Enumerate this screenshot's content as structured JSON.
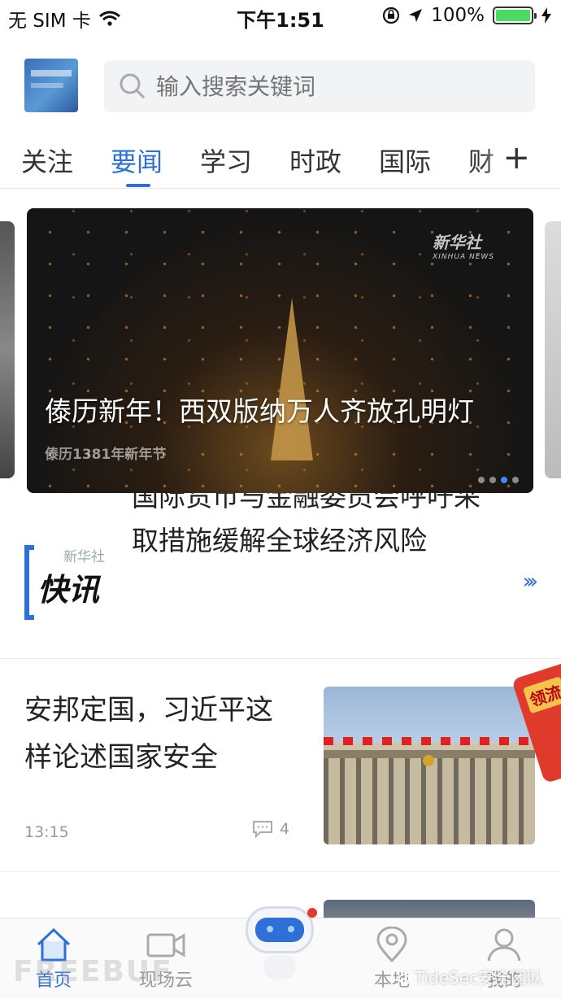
{
  "status_bar": {
    "carrier": "无 SIM 卡",
    "time": "下午1:51",
    "battery": "100%"
  },
  "header": {
    "search_placeholder": "输入搜索关键词"
  },
  "tabs": [
    {
      "label": "关注"
    },
    {
      "label": "要闻"
    },
    {
      "label": "学习"
    },
    {
      "label": "时政"
    },
    {
      "label": "国际"
    },
    {
      "label": "财"
    }
  ],
  "active_tab": "要闻",
  "carousel": {
    "title": "傣历新年！西双版纳万人齐放孔明灯",
    "brand": "新华社",
    "brand_sub": "XINHUA NEWS",
    "overlay_caption": "傣历1381年新年节",
    "dots": 4,
    "active_dot": 3
  },
  "flash": {
    "brand": "新华社",
    "logo_text": "快讯",
    "text": "国际货币与金融委员会呼吁采取措施缓解全球经济风险"
  },
  "article": {
    "title": "安邦定国，习近平这样论述国家安全",
    "time": "13:15",
    "comments": "4"
  },
  "red_packet": {
    "label": "领流"
  },
  "tabbar": {
    "home": "首页",
    "live": "现场云",
    "local": "本地",
    "mine": "我的"
  },
  "watermarks": {
    "left": "FREEBUF",
    "right": "TideSec安全团队"
  },
  "colors": {
    "accent": "#2f6fd8",
    "battery": "#4cd964",
    "red_packet": "#e03a2c"
  }
}
